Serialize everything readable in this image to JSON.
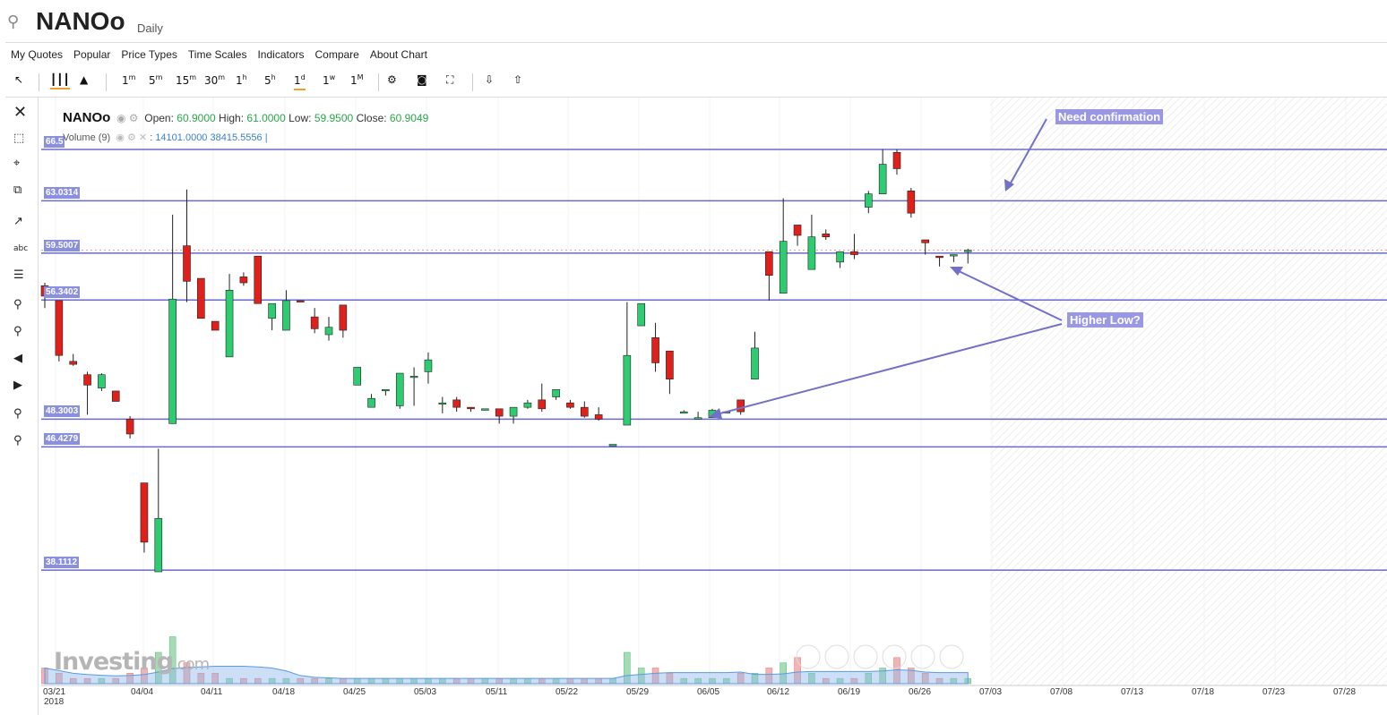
{
  "header": {
    "title": "NANOo",
    "timeframe": "Daily",
    "search_icon": "search-icon"
  },
  "menu": [
    "My Quotes",
    "Popular",
    "Price Types",
    "Time Scales",
    "Indicators",
    "Compare",
    "About Chart"
  ],
  "toolbar": {
    "intervals": [
      {
        "base": "1",
        "sup": "m"
      },
      {
        "base": "5",
        "sup": "m"
      },
      {
        "base": "15",
        "sup": "m"
      },
      {
        "base": "30",
        "sup": "m"
      },
      {
        "base": "1",
        "sup": "h"
      },
      {
        "base": "5",
        "sup": "h"
      },
      {
        "base": "1",
        "sup": "d"
      },
      {
        "base": "1",
        "sup": "w"
      },
      {
        "base": "1",
        "sup": "M"
      }
    ],
    "active_interval": "1d"
  },
  "legend": {
    "symbol": "NANOo",
    "open_label": "Open:",
    "open": "60.9000",
    "high_label": "High:",
    "high": "61.0000",
    "low_label": "Low:",
    "low": "59.9500",
    "close_label": "Close:",
    "close": "60.9049",
    "volume_label": "Volume (9)",
    "volume_sep": ":",
    "volume_value": "14101.0000",
    "volume_ma": "38415.5556"
  },
  "annotations": {
    "need_confirmation": "Need confirmation",
    "higher_low": "Higher Low?"
  },
  "watermark": {
    "brand": "Investing",
    "suffix": ".com"
  },
  "colors": {
    "up": "#2ecc71",
    "down": "#e0201b",
    "hline": "#6a6ad0",
    "label_bg": "#8a8fe0",
    "annotation_bg": "#9a98e4",
    "volume_area": "#8fb9ea"
  },
  "chart_data": {
    "type": "candlestick",
    "ylim": [
      34.8,
      70.0
    ],
    "horizontal_levels": [
      {
        "value": 66.5,
        "label": "66.5"
      },
      {
        "value": 63.0314,
        "label": "63.0314"
      },
      {
        "value": 59.5007,
        "label": "59.5007"
      },
      {
        "value": 56.3402,
        "label": "56.3402"
      },
      {
        "value": 48.3003,
        "label": "48.3003"
      },
      {
        "value": 46.4279,
        "label": "46.4279"
      },
      {
        "value": 38.1112,
        "label": "38.1112"
      }
    ],
    "x_ticks": [
      "03/21",
      "04/04",
      "04/11",
      "04/18",
      "04/25",
      "05/03",
      "05/11",
      "05/22",
      "05/29",
      "06/05",
      "06/12",
      "06/19",
      "06/26",
      "07/03",
      "07/08",
      "07/13",
      "07/18",
      "07/23",
      "07/28"
    ],
    "x_year_label": "2018",
    "candles": [
      {
        "o": 57.3,
        "h": 57.5,
        "l": 55.8,
        "c": 56.6
      },
      {
        "o": 56.3,
        "h": 56.3,
        "l": 52.2,
        "c": 52.6
      },
      {
        "o": 52.2,
        "h": 52.7,
        "l": 51.9,
        "c": 52.0
      },
      {
        "o": 51.3,
        "h": 51.5,
        "l": 48.6,
        "c": 50.6
      },
      {
        "o": 50.4,
        "h": 51.4,
        "l": 50.2,
        "c": 51.3
      },
      {
        "o": 50.2,
        "h": 50.2,
        "l": 49.5,
        "c": 49.5
      },
      {
        "o": 48.3,
        "h": 48.5,
        "l": 47.0,
        "c": 47.3
      },
      {
        "o": 44.0,
        "h": 44.0,
        "l": 39.3,
        "c": 40.0
      },
      {
        "o": 38.0,
        "h": 46.3,
        "l": 38.0,
        "c": 41.6
      },
      {
        "o": 48.0,
        "h": 62.1,
        "l": 48.0,
        "c": 56.4
      },
      {
        "o": 60.0,
        "h": 63.8,
        "l": 56.2,
        "c": 57.6
      },
      {
        "o": 57.8,
        "h": 57.7,
        "l": 55.9,
        "c": 55.1
      },
      {
        "o": 54.9,
        "h": 54.8,
        "l": 54.3,
        "c": 54.3
      },
      {
        "o": 52.5,
        "h": 58.1,
        "l": 52.5,
        "c": 57.0
      },
      {
        "o": 57.9,
        "h": 58.2,
        "l": 57.3,
        "c": 57.5
      },
      {
        "o": 59.3,
        "h": 59.3,
        "l": 56.9,
        "c": 56.1
      },
      {
        "o": 55.1,
        "h": 55.8,
        "l": 54.3,
        "c": 56.1
      },
      {
        "o": 54.3,
        "h": 57.0,
        "l": 54.3,
        "c": 56.3
      },
      {
        "o": 56.3,
        "h": 56.2,
        "l": 56.2,
        "c": 56.2
      },
      {
        "o": 55.2,
        "h": 55.8,
        "l": 54.1,
        "c": 54.4
      },
      {
        "o": 54.0,
        "h": 55.2,
        "l": 53.6,
        "c": 54.5
      },
      {
        "o": 56.0,
        "h": 56.0,
        "l": 53.8,
        "c": 54.3
      },
      {
        "o": 50.6,
        "h": 51.0,
        "l": 50.6,
        "c": 51.8
      },
      {
        "o": 49.1,
        "h": 50.0,
        "l": 49.1,
        "c": 49.7
      },
      {
        "o": 50.3,
        "h": 50.3,
        "l": 49.9,
        "c": 50.3
      },
      {
        "o": 49.2,
        "h": 51.2,
        "l": 49.0,
        "c": 51.4
      },
      {
        "o": 51.2,
        "h": 51.8,
        "l": 49.2,
        "c": 51.2
      },
      {
        "o": 51.5,
        "h": 52.8,
        "l": 50.7,
        "c": 52.3
      },
      {
        "o": 49.4,
        "h": 49.8,
        "l": 48.7,
        "c": 49.4
      },
      {
        "o": 49.6,
        "h": 49.8,
        "l": 48.8,
        "c": 49.1
      },
      {
        "o": 49.1,
        "h": 49.0,
        "l": 48.8,
        "c": 49.0
      },
      {
        "o": 48.9,
        "h": 48.9,
        "l": 48.9,
        "c": 49.0
      },
      {
        "o": 49.0,
        "h": 49.0,
        "l": 48.0,
        "c": 48.5
      },
      {
        "o": 48.5,
        "h": 49.1,
        "l": 48.0,
        "c": 49.1
      },
      {
        "o": 49.1,
        "h": 49.6,
        "l": 49.0,
        "c": 49.4
      },
      {
        "o": 49.6,
        "h": 50.7,
        "l": 48.8,
        "c": 49.0
      },
      {
        "o": 49.8,
        "h": 50.3,
        "l": 49.6,
        "c": 50.3
      },
      {
        "o": 49.4,
        "h": 49.6,
        "l": 49.0,
        "c": 49.1
      },
      {
        "o": 49.1,
        "h": 49.5,
        "l": 48.4,
        "c": 48.5
      },
      {
        "o": 48.6,
        "h": 49.1,
        "l": 48.2,
        "c": 48.3
      },
      {
        "o": 46.5,
        "h": 46.5,
        "l": 46.5,
        "c": 46.6
      },
      {
        "o": 47.9,
        "h": 56.2,
        "l": 47.9,
        "c": 52.6
      },
      {
        "o": 54.6,
        "h": 56.1,
        "l": 54.6,
        "c": 56.1
      },
      {
        "o": 53.8,
        "h": 54.8,
        "l": 51.5,
        "c": 52.1
      },
      {
        "o": 52.9,
        "h": 52.9,
        "l": 50.0,
        "c": 51.0
      },
      {
        "o": 48.7,
        "h": 48.9,
        "l": 48.7,
        "c": 48.8
      },
      {
        "o": 48.3,
        "h": 48.8,
        "l": 48.3,
        "c": 48.4
      },
      {
        "o": 48.4,
        "h": 49.0,
        "l": 48.4,
        "c": 48.9
      },
      {
        "o": 48.8,
        "h": 48.8,
        "l": 48.8,
        "c": 48.8
      },
      {
        "o": 49.6,
        "h": 49.6,
        "l": 48.6,
        "c": 48.8
      },
      {
        "o": 51.0,
        "h": 54.2,
        "l": 51.0,
        "c": 53.1
      },
      {
        "o": 59.6,
        "h": 59.6,
        "l": 56.3,
        "c": 58.0
      },
      {
        "o": 56.8,
        "h": 63.2,
        "l": 56.8,
        "c": 60.3
      },
      {
        "o": 61.4,
        "h": 61.4,
        "l": 60.0,
        "c": 60.7
      },
      {
        "o": 58.4,
        "h": 62.1,
        "l": 58.4,
        "c": 60.6
      },
      {
        "o": 60.8,
        "h": 61.1,
        "l": 60.4,
        "c": 60.6
      },
      {
        "o": 58.9,
        "h": 59.6,
        "l": 58.5,
        "c": 59.6
      },
      {
        "o": 59.6,
        "h": 60.8,
        "l": 59.1,
        "c": 59.4
      },
      {
        "o": 62.6,
        "h": 63.7,
        "l": 62.2,
        "c": 63.5
      },
      {
        "o": 63.5,
        "h": 66.5,
        "l": 63.5,
        "c": 65.5
      },
      {
        "o": 66.3,
        "h": 66.5,
        "l": 64.8,
        "c": 65.2
      },
      {
        "o": 63.7,
        "h": 63.9,
        "l": 61.9,
        "c": 62.2
      },
      {
        "o": 60.4,
        "h": 60.4,
        "l": 59.4,
        "c": 60.2
      },
      {
        "o": 59.3,
        "h": 59.3,
        "l": 58.6,
        "c": 59.2
      },
      {
        "o": 59.4,
        "h": 59.4,
        "l": 58.9,
        "c": 59.4
      },
      {
        "o": 59.6,
        "h": 59.8,
        "l": 58.8,
        "c": 59.7
      }
    ],
    "volume": [
      3,
      2,
      1,
      1,
      1,
      1,
      2,
      3,
      6,
      9,
      4,
      2,
      2,
      1,
      1,
      1,
      1,
      1,
      1,
      1,
      1,
      1,
      1,
      1,
      1,
      1,
      1,
      1,
      1,
      1,
      1,
      1,
      1,
      1,
      1,
      1,
      1,
      1,
      1,
      1,
      1,
      6,
      3,
      3,
      2,
      1,
      1,
      1,
      1,
      2,
      2,
      3,
      4,
      5,
      2,
      1,
      1,
      1,
      2,
      3,
      5,
      3,
      2,
      1,
      1,
      1
    ]
  }
}
